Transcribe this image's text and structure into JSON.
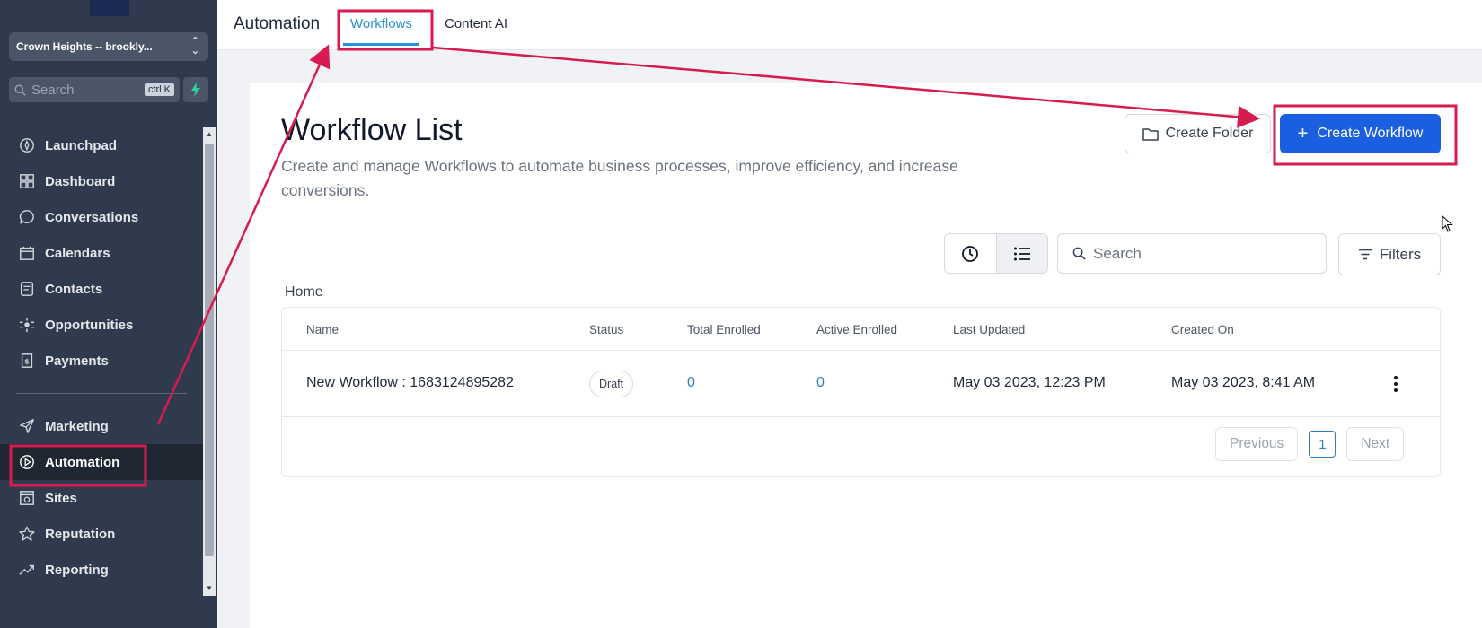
{
  "sidebar": {
    "location": "Crown Heights -- brookly...",
    "search": {
      "placeholder": "Search",
      "shortcut": "ctrl K"
    },
    "nav_items": [
      {
        "label": "Launchpad",
        "icon": "launchpad-icon"
      },
      {
        "label": "Dashboard",
        "icon": "dashboard-icon"
      },
      {
        "label": "Conversations",
        "icon": "chat-bubble-icon"
      },
      {
        "label": "Calendars",
        "icon": "calendar-icon"
      },
      {
        "label": "Contacts",
        "icon": "contact-card-icon"
      },
      {
        "label": "Opportunities",
        "icon": "opportunities-icon"
      },
      {
        "label": "Payments",
        "icon": "payments-icon"
      },
      {
        "label": "Marketing",
        "icon": "send-icon"
      },
      {
        "label": "Automation",
        "icon": "automation-icon",
        "active": true
      },
      {
        "label": "Sites",
        "icon": "sites-icon"
      },
      {
        "label": "Reputation",
        "icon": "star-icon"
      },
      {
        "label": "Reporting",
        "icon": "trend-icon"
      }
    ]
  },
  "header": {
    "title": "Automation",
    "tabs": [
      {
        "label": "Workflows",
        "active": true
      },
      {
        "label": "Content AI",
        "active": false
      }
    ]
  },
  "main": {
    "title": "Workflow List",
    "description": "Create and manage Workflows to automate business processes, improve efficiency, and increase conversions.",
    "create_folder_label": "Create Folder",
    "create_workflow_label": "Create Workflow",
    "search_placeholder": "Search",
    "filters_label": "Filters",
    "breadcrumb": "Home",
    "table": {
      "columns": [
        "Name",
        "Status",
        "Total Enrolled",
        "Active Enrolled",
        "Last Updated",
        "Created On"
      ],
      "rows": [
        {
          "name": "New Workflow : 1683124895282",
          "status": "Draft",
          "total_enrolled": "0",
          "active_enrolled": "0",
          "last_updated": "May 03 2023, 12:23 PM",
          "created_on": "May 03 2023, 8:41 AM"
        }
      ]
    },
    "pagination": {
      "previous": "Previous",
      "current_page": "1",
      "next": "Next"
    }
  },
  "colors": {
    "sidebar_bg": "#2f3b4d",
    "primary": "#1a5fe0",
    "tab_active": "#2d8fd5",
    "annotation": "#d81b4f"
  }
}
